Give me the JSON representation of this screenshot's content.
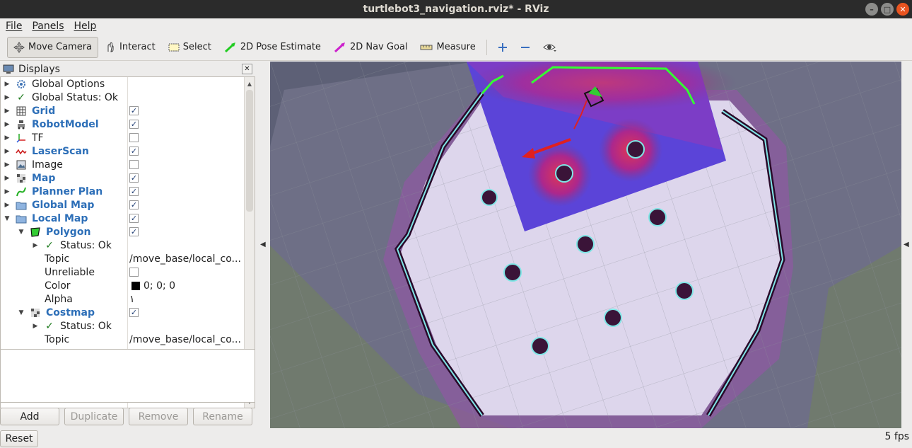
{
  "window": {
    "title": "turtlebot3_navigation.rviz* - RViz",
    "buttons": [
      "–",
      "□",
      "✕"
    ]
  },
  "menu": [
    "File",
    "Panels",
    "Help"
  ],
  "toolbar": {
    "tools": [
      {
        "label": "Move Camera",
        "icon": "move-camera-icon",
        "active": true
      },
      {
        "label": "Interact",
        "icon": "hand-icon",
        "active": false
      },
      {
        "label": "Select",
        "icon": "select-box-icon",
        "active": false
      },
      {
        "label": "2D Pose Estimate",
        "icon": "pose-arrow-icon",
        "active": false,
        "color": "#22cc22"
      },
      {
        "label": "2D Nav Goal",
        "icon": "goal-arrow-icon",
        "active": false,
        "color": "#cc22cc"
      },
      {
        "label": "Measure",
        "icon": "ruler-icon",
        "active": false
      }
    ],
    "extra_icons": [
      "plus-icon",
      "minus-icon",
      "eye-icon"
    ]
  },
  "displays_panel": {
    "title": "Displays",
    "rows": [
      {
        "label": "Global Options",
        "icon": "gear-icon",
        "bold": false
      },
      {
        "label": "Global Status: Ok",
        "icon": "check-icon",
        "bold": false
      },
      {
        "label": "Grid",
        "icon": "grid-icon",
        "bold": true,
        "checked": true
      },
      {
        "label": "RobotModel",
        "icon": "robot-icon",
        "bold": true,
        "checked": true
      },
      {
        "label": "TF",
        "icon": "tf-icon",
        "bold": false,
        "checked": false
      },
      {
        "label": "LaserScan",
        "icon": "laser-icon",
        "bold": true,
        "checked": true
      },
      {
        "label": "Image",
        "icon": "image-icon",
        "bold": false,
        "checked": false
      },
      {
        "label": "Map",
        "icon": "map-icon",
        "bold": true,
        "checked": true
      },
      {
        "label": "Planner Plan",
        "icon": "path-icon",
        "bold": true,
        "checked": true
      },
      {
        "label": "Global Map",
        "icon": "folder-icon",
        "bold": true,
        "checked": true
      },
      {
        "label": "Local Map",
        "icon": "folder-icon",
        "bold": true,
        "checked": true
      },
      {
        "label": "Polygon",
        "icon": "polygon-icon",
        "bold": true,
        "checked": true
      },
      {
        "label": "Status: Ok",
        "icon": "check-icon",
        "bold": false
      },
      {
        "label": "Topic",
        "value": "/move_base/local_co..."
      },
      {
        "label": "Unreliable",
        "checked": false
      },
      {
        "label": "Color",
        "value": "0; 0; 0",
        "swatch": "#000000"
      },
      {
        "label": "Alpha",
        "value": "١"
      },
      {
        "label": "Costmap",
        "icon": "map-icon",
        "bold": true,
        "checked": true
      },
      {
        "label": "Status: Ok",
        "icon": "check-icon",
        "bold": false
      },
      {
        "label": "Topic",
        "value": "/move_base/local_co..."
      }
    ]
  },
  "buttons": {
    "add": "Add",
    "duplicate": "Duplicate",
    "remove": "Remove",
    "rename": "Rename",
    "reset": "Reset"
  },
  "status": {
    "fps": "5 fps"
  },
  "colors": {
    "accent_blue": "#2d6fb8",
    "titlebar": "#2b2b2b",
    "close_button": "#e95420"
  }
}
